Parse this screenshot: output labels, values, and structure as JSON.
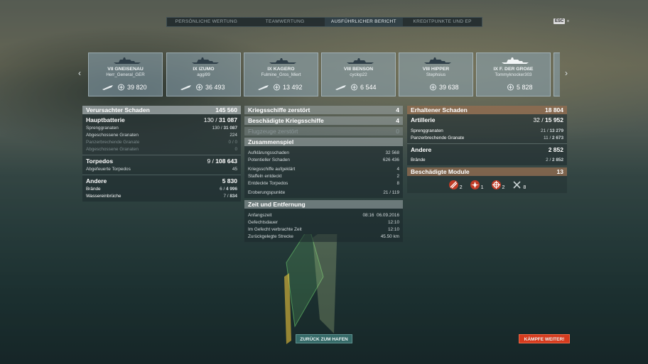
{
  "tabs": [
    {
      "label": "Persönliche Wertung",
      "active": false
    },
    {
      "label": "Teamwertung",
      "active": false
    },
    {
      "label": "Ausführlicher Bericht",
      "active": true
    },
    {
      "label": "Kreditpunkte und EP",
      "active": false
    }
  ],
  "esc": {
    "key": "ESC",
    "close": "×"
  },
  "ships": [
    {
      "name": "VII GNEISENAU",
      "player": "Herr_General_GER",
      "value": "39 820"
    },
    {
      "name": "IX IZUMO",
      "player": "aggi99",
      "value": "36 493"
    },
    {
      "name": "IX KAGERO",
      "player": "Fulmine_Gros_Miert",
      "value": "13 492"
    },
    {
      "name": "VIII BENSON",
      "player": "cyclop22",
      "value": "6 544"
    },
    {
      "name": "VIII HIPPER",
      "player": "Stephsius",
      "value": "39 638"
    },
    {
      "name": "IX F. DER GROßE",
      "player": "Tommyknocker303",
      "value": "5 828"
    }
  ],
  "left": {
    "header": {
      "label": "Verursachter Schaden",
      "value": "145 560"
    },
    "main_battery": {
      "label": "Hauptbatterie",
      "value_a": "130 / ",
      "value_b": "31 087",
      "rows": [
        {
          "label": "Sprenggranaten",
          "value_a": "130 / ",
          "value_b": "31 087",
          "dim": false
        },
        {
          "label": "Abgeschossene Granaten",
          "value_a": "",
          "value_b": "224",
          "dim": false
        },
        {
          "label": "Panzerbrechende Granate",
          "value_a": "0 / ",
          "value_b": "0",
          "dim": true
        },
        {
          "label": "Abgeschossene Granaten",
          "value_a": "",
          "value_b": "0",
          "dim": true
        }
      ]
    },
    "torpedos": {
      "label": "Torpedos",
      "value_a": "9 / ",
      "value_b": "108 643",
      "rows": [
        {
          "label": "Abgefeuerte Torpedos",
          "value": "45"
        }
      ]
    },
    "other": {
      "label": "Andere",
      "value": "5 830",
      "rows": [
        {
          "label": "Brände",
          "value_a": "6 / ",
          "value_b": "4 996"
        },
        {
          "label": "Wassereinbrüche",
          "value_a": "7 / ",
          "value_b": "834"
        }
      ]
    }
  },
  "middle": {
    "destroyed": {
      "label": "Kriegsschiffe zerstört",
      "value": "4"
    },
    "damaged": {
      "label": "Beschädigte Kriegsschiffe",
      "value": "4"
    },
    "planes": {
      "label": "Flugzeuge zerstört",
      "value": "0"
    },
    "team": {
      "label": "Zusammenspiel",
      "rows": [
        {
          "label": "Aufklärungsschaden",
          "value": "32 568"
        },
        {
          "label": "Potentieller Schaden",
          "value": "626 436"
        },
        {
          "label": "Kriegsschiffe aufgeklärt",
          "value": "4"
        },
        {
          "label": "Staffeln entdeckt",
          "value": "2"
        },
        {
          "label": "Entdeckte Torpedos",
          "value": "8"
        },
        {
          "label": "Eroberungspunkte",
          "value": "21 / 119"
        }
      ]
    },
    "time": {
      "label": "Zeit und Entfernung",
      "rows": [
        {
          "label": "Anfangszeit",
          "value": "08:16  06.09.2016"
        },
        {
          "label": "Gefechtsdauer",
          "value": "12:10"
        },
        {
          "label": "Im Gefecht verbrachte Zeit",
          "value": "12:10"
        },
        {
          "label": "Zurückgelegte Strecke",
          "value": "45.50 km"
        }
      ]
    }
  },
  "right": {
    "header": {
      "label": "Erhaltener Schaden",
      "value": "18 804"
    },
    "artillery": {
      "label": "Artillerie",
      "value_a": "32 / ",
      "value_b": "15 952",
      "rows": [
        {
          "label": "Sprenggranaten",
          "value_a": "21 / ",
          "value_b": "13 279"
        },
        {
          "label": "Panzerbrechende Granate",
          "value_a": "11 / ",
          "value_b": "2 673"
        }
      ]
    },
    "other": {
      "label": "Andere",
      "value": "2 852",
      "rows": [
        {
          "label": "Brände",
          "value_a": "2 / ",
          "value_b": "2 852"
        }
      ]
    },
    "modules": {
      "label": "Beschädigte Module",
      "value": "13",
      "items": [
        {
          "icon": "gun-module-icon",
          "count": "2"
        },
        {
          "icon": "engine-module-icon",
          "count": "1"
        },
        {
          "icon": "steering-module-icon",
          "count": "2"
        },
        {
          "icon": "aa-module-icon",
          "count": "8"
        }
      ]
    }
  },
  "buttons": {
    "back": "Zurück zum Hafen",
    "fight": "Kämpfe weiter!"
  },
  "colors": {
    "accent_orange": "#d63b1e",
    "back_teal": "#356a68",
    "module_red": "#c23b26"
  }
}
